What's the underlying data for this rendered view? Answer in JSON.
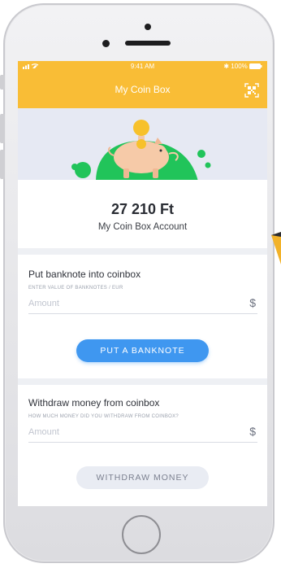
{
  "status_bar": {
    "time": "9:41 AM",
    "battery": "100%"
  },
  "app_bar": {
    "title": "My Coin Box",
    "qr_icon": "qr-code-icon"
  },
  "account": {
    "balance": "27 210 Ft",
    "label": "My Coin Box Account"
  },
  "deposit": {
    "title": "Put banknote into coinbox",
    "subtitle": "ENTER VALUE OF BANKNOTES / EUR",
    "placeholder": "Amount",
    "currency_symbol": "$",
    "button_label": "PUT A BANKNOTE"
  },
  "withdraw": {
    "title": "Withdraw money from coinbox",
    "subtitle": "HOW MUCH MONEY DID YOU WITHDRAW FROM COINBOX?",
    "placeholder": "Amount",
    "currency_symbol": "$",
    "button_label": "WITHDRAW MONEY"
  },
  "colors": {
    "accent": "#f9bd36",
    "primary_button": "#3f97f0",
    "hero_green": "#21c45a",
    "coin": "#f7c12b"
  }
}
